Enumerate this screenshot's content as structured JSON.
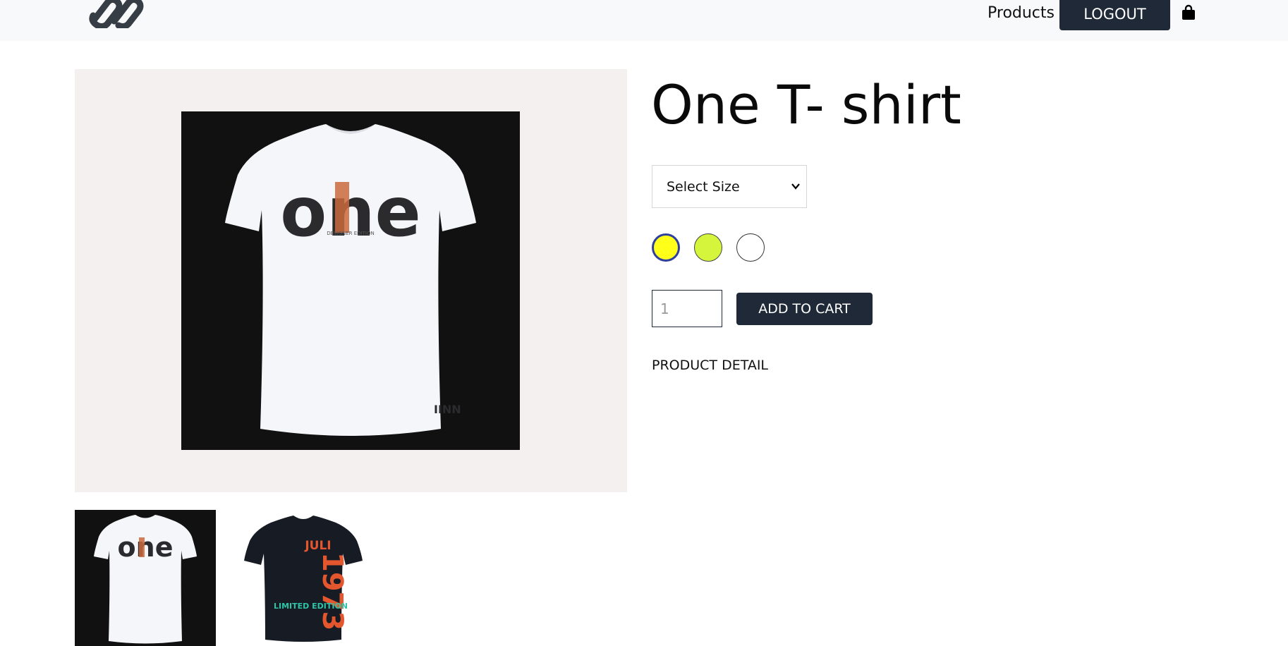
{
  "header": {
    "logo_icon": "chain-link-logo",
    "nav_products": "Products",
    "logout_label": "LOGOUT",
    "cart_icon": "shopping-bag-icon"
  },
  "product": {
    "title": "One T- shirt",
    "size_select": {
      "selected": "Select Size"
    },
    "colors": [
      {
        "hex": "#ffff1a",
        "selected": true
      },
      {
        "hex": "#d4f53c",
        "selected": false
      },
      {
        "hex": "#ffffff",
        "selected": false
      }
    ],
    "quantity_placeholder": "1",
    "add_to_cart_label": "ADD TO CART",
    "detail_label": "PRODUCT DETAIL"
  },
  "images": {
    "main": {
      "shirt_text": "one"
    },
    "thumbnails": [
      {
        "shirt_text": "one"
      },
      {
        "shirt_text_top": "JULI",
        "shirt_text_year": "1973",
        "shirt_text_left": "LIMITED EDITION"
      }
    ]
  },
  "colors": {
    "header_bg": "#f8f9fb",
    "button_dark": "#1f2937",
    "image_panel_bg": "#f4f0ef"
  }
}
